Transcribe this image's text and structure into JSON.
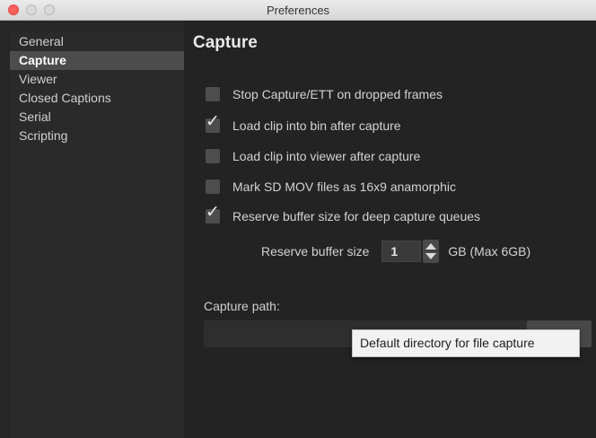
{
  "window": {
    "title": "Preferences"
  },
  "sidebar": {
    "items": [
      {
        "label": "General",
        "selected": false
      },
      {
        "label": "Capture",
        "selected": true
      },
      {
        "label": "Viewer",
        "selected": false
      },
      {
        "label": "Closed Captions",
        "selected": false
      },
      {
        "label": "Serial",
        "selected": false
      },
      {
        "label": "Scripting",
        "selected": false
      }
    ]
  },
  "main": {
    "title": "Capture",
    "options": [
      {
        "label": "Stop Capture/ETT on dropped frames",
        "checked": false
      },
      {
        "label": "Load clip into bin after capture",
        "checked": true
      },
      {
        "label": "Load clip into viewer after capture",
        "checked": false
      },
      {
        "label": "Mark SD MOV files as 16x9 anamorphic",
        "checked": false
      },
      {
        "label": "Reserve buffer size for deep capture queues",
        "checked": true
      }
    ],
    "buffer": {
      "label": "Reserve buffer size",
      "value": "1",
      "unit": "GB (Max 6GB)"
    },
    "capture_path": {
      "label": "Capture path:",
      "value": ""
    }
  },
  "tooltip": {
    "text": "Default directory for file capture"
  },
  "icons": {
    "check": "checkmark-icon",
    "stepper_up": "arrow-up-icon",
    "stepper_down": "arrow-down-icon"
  }
}
